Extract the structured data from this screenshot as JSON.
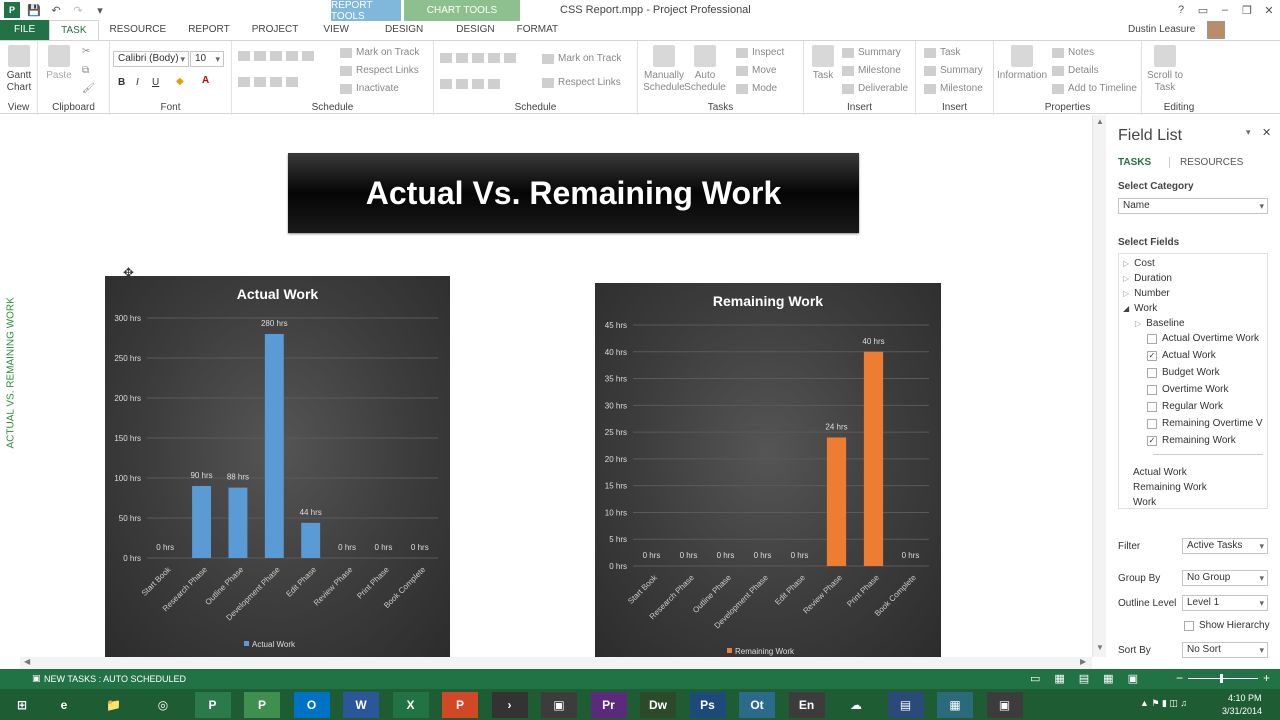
{
  "titlebar": {
    "title": "CSS Report.mpp - Project Professional",
    "context_report": "REPORT TOOLS",
    "context_chart": "CHART TOOLS",
    "user": "Dustin Leasure"
  },
  "tabs": [
    "FILE",
    "TASK",
    "RESOURCE",
    "REPORT",
    "PROJECT",
    "VIEW",
    "DESIGN",
    "DESIGN",
    "FORMAT"
  ],
  "ribbon": {
    "view": {
      "button": "Gantt Chart",
      "label": "View"
    },
    "clipboard": {
      "paste": "Paste",
      "label": "Clipboard"
    },
    "font": {
      "name": "Calibri (Body)",
      "size": "10",
      "label": "Font",
      "bold": "B",
      "italic": "I",
      "underline": "U"
    },
    "schedule1": {
      "mark": "Mark on Track",
      "respect": "Respect Links",
      "inactivate": "Inactivate",
      "label": "Schedule"
    },
    "schedule2": {
      "mark": "Mark on Track",
      "respect": "Respect Links",
      "label": "Schedule"
    },
    "tasks": {
      "manual": "Manually Schedule",
      "auto": "Auto Schedule",
      "inspect": "Inspect",
      "move": "Move",
      "mode": "Mode",
      "label": "Tasks"
    },
    "insert1": {
      "task": "Task",
      "summary": "Summary",
      "milestone": "Milestone",
      "deliverable": "Deliverable",
      "label": "Insert"
    },
    "insert2": {
      "task": "Task",
      "summary": "Summary",
      "milestone": "Milestone",
      "label": "Insert"
    },
    "properties": {
      "information": "Information",
      "notes": "Notes",
      "details": "Details",
      "timeline": "Add to Timeline",
      "label": "Properties"
    },
    "editing": {
      "scroll": "Scroll to Task",
      "label": "Editing"
    }
  },
  "report": {
    "banner": "Actual Vs. Remaining Work",
    "side_title": "ACTUAL VS. REMAINING WORK"
  },
  "chart_data": [
    {
      "type": "bar",
      "title": "Actual Work",
      "categories": [
        "Start Book",
        "Research Phase",
        "Outline Phase",
        "Development Phase",
        "Edit Phase",
        "Review Phase",
        "Print Phase",
        "Book Complete"
      ],
      "series": [
        {
          "name": "Actual Work",
          "values": [
            0,
            90,
            88,
            280,
            44,
            0,
            0,
            0
          ]
        }
      ],
      "data_labels": [
        "0 hrs",
        "90 hrs",
        "88 hrs",
        "280 hrs",
        "44 hrs",
        "0 hrs",
        "0 hrs",
        "0 hrs"
      ],
      "ylim": [
        0,
        300
      ],
      "yticks": [
        "0 hrs",
        "50 hrs",
        "100 hrs",
        "150 hrs",
        "200 hrs",
        "250 hrs",
        "300 hrs"
      ],
      "color": "#5b9bd5",
      "legend": "bottom"
    },
    {
      "type": "bar",
      "title": "Remaining Work",
      "categories": [
        "Start Book",
        "Research Phase",
        "Outline Phase",
        "Development Phase",
        "Edit Phase",
        "Review Phase",
        "Print Phase",
        "Book Complete"
      ],
      "series": [
        {
          "name": "Remaining Work",
          "values": [
            0,
            0,
            0,
            0,
            0,
            24,
            40,
            0
          ]
        }
      ],
      "data_labels": [
        "0 hrs",
        "0 hrs",
        "0 hrs",
        "0 hrs",
        "0 hrs",
        "24 hrs",
        "40 hrs",
        "0 hrs"
      ],
      "ylim": [
        0,
        45
      ],
      "yticks": [
        "0 hrs",
        "5 hrs",
        "10 hrs",
        "15 hrs",
        "20 hrs",
        "25 hrs",
        "30 hrs",
        "35 hrs",
        "40 hrs",
        "45 hrs"
      ],
      "color": "#ed7d31",
      "legend": "bottom"
    }
  ],
  "field_list": {
    "title": "Field List",
    "tab_tasks": "TASKS",
    "tab_resources": "RESOURCES",
    "select_category_label": "Select Category",
    "category_value": "Name",
    "select_fields_label": "Select Fields",
    "tree": [
      "Cost",
      "Duration",
      "Number",
      "Work",
      "Baseline"
    ],
    "work_fields": [
      {
        "label": "Actual Overtime Work",
        "checked": false
      },
      {
        "label": "Actual Work",
        "checked": true
      },
      {
        "label": "Budget Work",
        "checked": false
      },
      {
        "label": "Overtime Work",
        "checked": false
      },
      {
        "label": "Regular Work",
        "checked": false
      },
      {
        "label": "Remaining Overtime V",
        "checked": false
      },
      {
        "label": "Remaining Work",
        "checked": true
      }
    ],
    "selected": [
      "Actual Work",
      "Remaining Work",
      "Work"
    ],
    "filter_label": "Filter",
    "filter_value": "Active Tasks",
    "group_label": "Group By",
    "group_value": "No Group",
    "outline_label": "Outline Level",
    "outline_value": "Level 1",
    "hierarchy_label": "Show Hierarchy",
    "sort_label": "Sort By",
    "sort_value": "No Sort"
  },
  "status": {
    "text": "NEW TASKS : AUTO SCHEDULED"
  },
  "taskbar": {
    "time": "4:10 PM",
    "date": "3/31/2014",
    "apps": [
      "e",
      "📁",
      "◎",
      "P",
      "P",
      "O",
      "W",
      "X",
      "P",
      "›",
      "▣",
      "Pr",
      "Dw",
      "Ps",
      "Ot",
      "En",
      "☁",
      "▤",
      "▦",
      "▣"
    ]
  }
}
